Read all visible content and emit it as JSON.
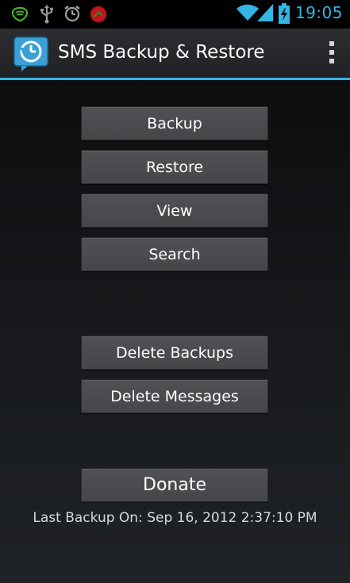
{
  "status_bar": {
    "time": "19:05",
    "icons": [
      "shield-icon",
      "usb-icon",
      "alarm-icon",
      "record-icon",
      "wifi-icon",
      "signal-icon",
      "battery-charging-icon"
    ],
    "accent_color": "#33b5e5"
  },
  "action_bar": {
    "title": "SMS Backup & Restore",
    "app_icon": "backup-clock-icon",
    "overflow_icon": "overflow-menu-icon"
  },
  "buttons": {
    "backup": "Backup",
    "restore": "Restore",
    "view": "View",
    "search": "Search",
    "delete_backups": "Delete Backups",
    "delete_messages": "Delete Messages",
    "donate": "Donate"
  },
  "footer": {
    "last_backup": "Last Backup On: Sep 16, 2012 2:37:10 PM"
  }
}
